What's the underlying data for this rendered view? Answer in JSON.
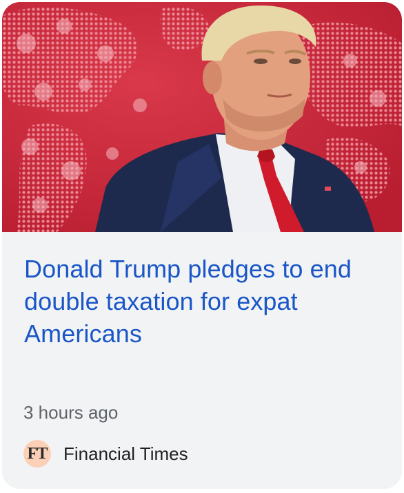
{
  "article": {
    "image_alt": "Donald Trump in front of a red world map",
    "headline": "Donald Trump pledges to end double taxation for expat Americans",
    "timestamp": "3 hours ago",
    "source": {
      "logo_text": "FT",
      "name": "Financial Times"
    }
  },
  "colors": {
    "card_background": "#f1f3f4",
    "headline": "#1a56c7",
    "timestamp": "#5f6368",
    "logo_background": "#fccfb7",
    "image_background": "#c9283a"
  }
}
